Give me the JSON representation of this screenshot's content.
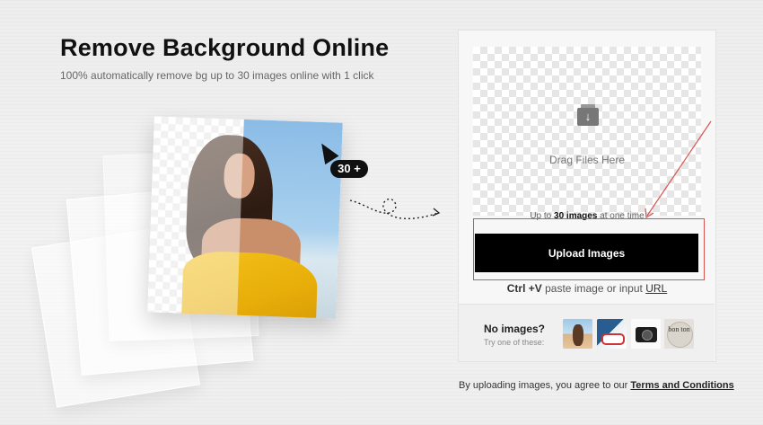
{
  "hero": {
    "title": "Remove Background Online",
    "subtitle": "100% automatically remove bg up to 30 images online with 1 click",
    "badge": "30 +"
  },
  "upload": {
    "drop_text": "Drag Files Here",
    "limit_prefix": "Up to",
    "limit_bold": "30 images",
    "limit_suffix": "at one time",
    "button_label": "Upload Images",
    "paste_shortcut": "Ctrl +V",
    "paste_text": "paste image or input",
    "paste_link": "URL"
  },
  "samples": {
    "heading": "No images?",
    "subheading": "Try one of these:",
    "thumb4_text": "bon ton"
  },
  "footer": {
    "terms_prefix": "By uploading images, you agree to our",
    "terms_link": "Terms and Conditions"
  },
  "colors": {
    "accent": "#000000",
    "annotation": "#d9534f"
  }
}
